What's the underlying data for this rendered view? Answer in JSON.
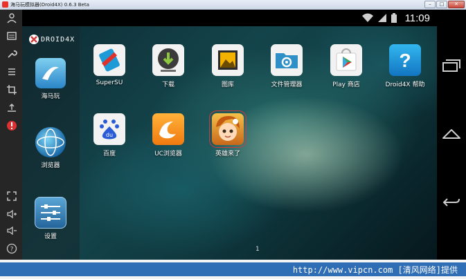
{
  "window": {
    "title": "海马玩模拟器(Droid4X) 0.6.3 Beta"
  },
  "status": {
    "time": "11:09"
  },
  "logo": {
    "text": "DROID4X"
  },
  "dock": [
    {
      "label": "海马玩",
      "icon": "haimawan-icon"
    },
    {
      "label": "浏览器",
      "icon": "globe-browser-icon"
    },
    {
      "label": "设置",
      "icon": "settings-sliders-icon"
    }
  ],
  "apps": [
    {
      "label": "SuperSU",
      "icon": "supersu-icon"
    },
    {
      "label": "下载",
      "icon": "download-icon"
    },
    {
      "label": "图库",
      "icon": "gallery-icon"
    },
    {
      "label": "文件管理器",
      "icon": "file-manager-icon"
    },
    {
      "label": "Play 商店",
      "icon": "play-store-icon"
    },
    {
      "label": "Droid4X 帮助",
      "icon": "help-icon"
    },
    {
      "label": "百度",
      "icon": "baidu-icon"
    },
    {
      "label": "UC浏览器",
      "icon": "uc-browser-icon"
    },
    {
      "label": "英雄来了",
      "icon": "hero-game-icon"
    }
  ],
  "page": {
    "indicator": "1"
  },
  "watermark": {
    "text": "http://www.vipcn.com [清风网络]提供"
  }
}
